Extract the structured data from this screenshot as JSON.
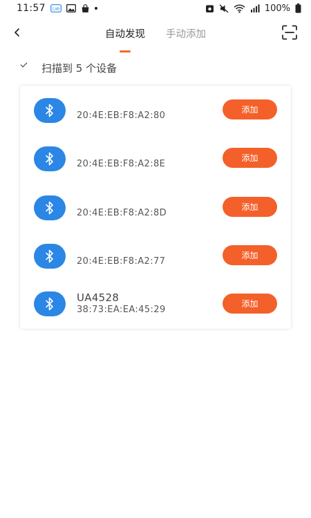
{
  "status_bar": {
    "time": "11:57",
    "battery_text": "100%"
  },
  "nav": {
    "tabs": [
      {
        "label": "自动发现",
        "active": true
      },
      {
        "label": "手动添加",
        "active": false
      }
    ]
  },
  "summary": {
    "text": "扫描到 5 个设备"
  },
  "devices": [
    {
      "name": "",
      "mac": "20:4E:EB:F8:A2:80",
      "add_label": "添加"
    },
    {
      "name": "",
      "mac": "20:4E:EB:F8:A2:8E",
      "add_label": "添加"
    },
    {
      "name": "",
      "mac": "20:4E:EB:F8:A2:8D",
      "add_label": "添加"
    },
    {
      "name": "",
      "mac": "20:4E:EB:F8:A2:77",
      "add_label": "添加"
    },
    {
      "name": "UA4528",
      "mac": "38:73:EA:EA:45:29",
      "add_label": "添加"
    }
  ],
  "colors": {
    "accent": "#f4602a",
    "bluetooth": "#2b86e6",
    "tab_indicator": "#f26a2b"
  }
}
